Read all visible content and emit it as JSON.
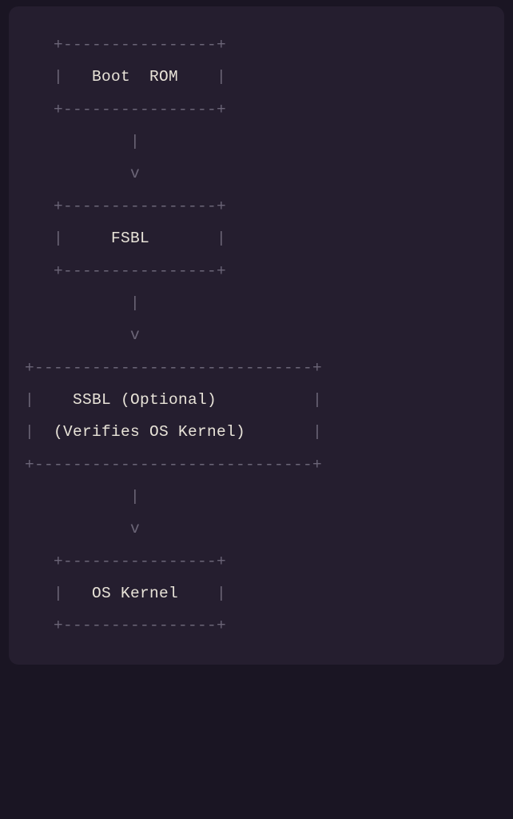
{
  "diagram": {
    "l01": "   +----------------+",
    "l02p": "   |   ",
    "l02t": "Boot  ROM",
    "l02s": "    |",
    "l03": "   +----------------+",
    "l04": "           |",
    "l05": "           v",
    "l06": "   +----------------+",
    "l07p": "   |     ",
    "l07t": "FSBL",
    "l07s": "       |",
    "l08": "   +----------------+",
    "l09": "           |",
    "l10": "           v",
    "l11": "+-----------------------------+",
    "l12p": "|    ",
    "l12t": "SSBL (Optional)",
    "l12s": "          |",
    "l13p": "|  ",
    "l13t": "(Verifies OS Kernel)",
    "l13s": "       |",
    "l14": "+-----------------------------+",
    "l15": "           |",
    "l16": "           v",
    "l17": "   +----------------+",
    "l18p": "   |   ",
    "l18t": "OS Kernel",
    "l18s": "    |",
    "l19": "   +----------------+"
  }
}
